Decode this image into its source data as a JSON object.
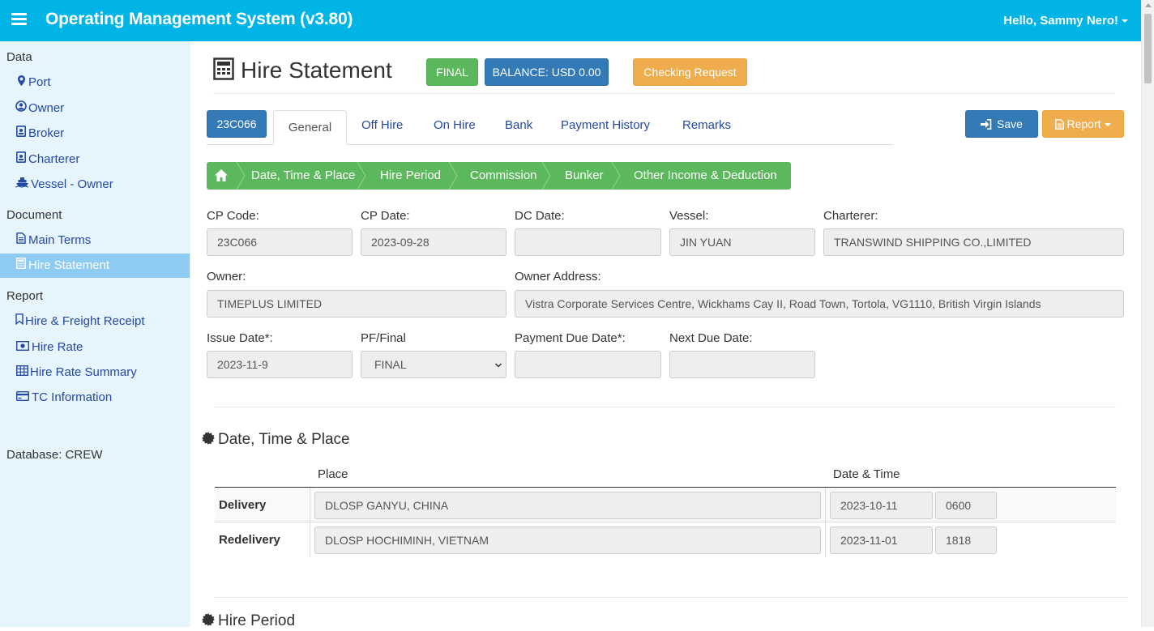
{
  "header": {
    "app_title": "Operating Management System (v3.80)",
    "user_greeting": "Hello, Sammy Nero!"
  },
  "sidebar": {
    "sections": [
      {
        "title": "Data",
        "items": [
          {
            "label": "Port",
            "icon": "map-marker-icon"
          },
          {
            "label": "Owner",
            "icon": "user-circle-icon"
          },
          {
            "label": "Broker",
            "icon": "id-badge-icon"
          },
          {
            "label": "Charterer",
            "icon": "id-badge-icon"
          },
          {
            "label": "Vessel - Owner",
            "icon": "ship-icon"
          }
        ]
      },
      {
        "title": "Document",
        "items": [
          {
            "label": "Main Terms",
            "icon": "file-icon"
          },
          {
            "label": "Hire Statement",
            "icon": "calculator-icon",
            "active": true
          }
        ]
      },
      {
        "title": "Report",
        "items": [
          {
            "label": "Hire & Freight Receipt",
            "icon": "bookmark-icon"
          },
          {
            "label": "Hire Rate",
            "icon": "money-icon"
          },
          {
            "label": "Hire Rate Summary",
            "icon": "table-icon"
          },
          {
            "label": "TC Information",
            "icon": "credit-card-icon"
          }
        ]
      }
    ],
    "database_label": "Database: CREW"
  },
  "page": {
    "title": "Hire Statement",
    "status_badge": "FINAL",
    "balance_badge": "BALANCE: USD 0.00",
    "checking_request_label": "Checking Request",
    "code_badge": "23C066",
    "save_label": "Save",
    "report_label": "Report"
  },
  "tabs": [
    "General",
    "Off Hire",
    "On Hire",
    "Bank",
    "Payment History",
    "Remarks"
  ],
  "breadcrumbs": [
    "Date, Time & Place",
    "Hire Period",
    "Commission",
    "Bunker",
    "Other Income & Deduction"
  ],
  "form": {
    "cp_code": {
      "label": "CP Code:",
      "value": "23C066"
    },
    "cp_date": {
      "label": "CP Date:",
      "value": "2023-09-28"
    },
    "dc_date": {
      "label": "DC Date:",
      "value": ""
    },
    "vessel": {
      "label": "Vessel:",
      "value": "JIN YUAN"
    },
    "charterer": {
      "label": "Charterer:",
      "value": "TRANSWIND SHIPPING CO.,LIMITED"
    },
    "owner": {
      "label": "Owner:",
      "value": "TIMEPLUS LIMITED"
    },
    "owner_address": {
      "label": "Owner Address:",
      "value": "Vistra Corporate Services Centre, Wickhams Cay II, Road Town, Tortola, VG1110, British Virgin Islands"
    },
    "issue_date": {
      "label": "Issue Date*:",
      "value": "2023-11-9"
    },
    "pf_final": {
      "label": "PF/Final",
      "value": "FINAL"
    },
    "payment_due_date": {
      "label": "Payment Due Date*:",
      "value": ""
    },
    "next_due_date": {
      "label": "Next Due Date:",
      "value": ""
    }
  },
  "date_time_place": {
    "title": "Date, Time & Place",
    "col_place": "Place",
    "col_datetime": "Date & Time",
    "rows": [
      {
        "label": "Delivery",
        "place": "DLOSP GANYU, CHINA",
        "date": "2023-10-11",
        "time": "0600"
      },
      {
        "label": "Redelivery",
        "place": "DLOSP HOCHIMINH, VIETNAM",
        "date": "2023-11-01",
        "time": "1818"
      }
    ]
  },
  "hire_period": {
    "title": "Hire Period"
  },
  "colors": {
    "navbar": "#00b4e6",
    "sidebar_bg": "#e6f4fb",
    "active_item": "#8ecbf3",
    "primary": "#337ab7",
    "success": "#5cb85c",
    "warning": "#f0ad4e",
    "link": "#2448a5"
  }
}
